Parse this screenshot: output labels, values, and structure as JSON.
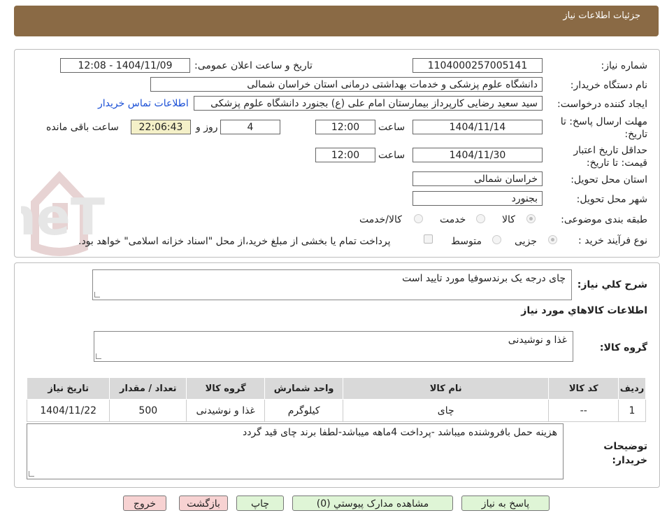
{
  "header": {
    "title": "جزئیات اطلاعات نیاز"
  },
  "labels": {
    "need_number": "شماره نیاز:",
    "announce_datetime": "تاریخ و ساعت اعلان عمومی:",
    "buyer_org": "نام دستگاه خریدار:",
    "requester": "ایجاد کننده درخواست:",
    "reply_deadline": "مهلت ارسال پاسخ: تا تاریخ:",
    "time": "ساعت",
    "days_and": "روز و",
    "remaining": "ساعت باقی مانده",
    "price_validity": "حداقل تاریخ اعتبار قیمت: تا تاریخ:",
    "province": "استان محل تحویل:",
    "city": "شهر محل تحویل:",
    "category": "طبقه بندی موضوعی:",
    "purchase_type": "نوع فرآیند خرید :",
    "general_desc": "شرح کلي نياز:",
    "goods_info": "اطلاعات کالاهاي مورد نياز",
    "goods_group": "گروه کالا:",
    "buyer_notes": "توضیحات خریدار:"
  },
  "values": {
    "need_number": "1104000257005141",
    "announce_datetime": "1404/11/09 - 12:08",
    "buyer_org": "دانشگاه علوم پزشکی و خدمات بهداشتی درمانی استان خراسان شمالی",
    "requester": "سید سعید رضایی کارپرداز بیمارستان امام علی (ع) بجنورد دانشگاه علوم پزشکی",
    "contact_link": "اطلاعات تماس خریدار",
    "reply_date": "1404/11/14",
    "reply_time": "12:00",
    "days": "4",
    "remaining_time": "22:06:43",
    "validity_date": "1404/11/30",
    "validity_time": "12:00",
    "province": "خراسان شمالی",
    "city": "بجنورد",
    "general_desc": "چای درجه یک برندسوفیا مورد تایید است",
    "goods_group": "غذا و نوشیدنی",
    "buyer_notes": "هزینه حمل بافروشنده میباشد -پرداخت 4ماهه میباشد-لطفا برند چای قید گردد"
  },
  "category_options": {
    "goods": "کالا",
    "service": "خدمت",
    "goods_service": "کالا/خدمت"
  },
  "purchase_options": {
    "partial": "جزیی",
    "medium": "متوسط",
    "treasury_note": "پرداخت تمام یا بخشی از مبلغ خرید،از محل \"اسناد خزانه اسلامی\" خواهد بود."
  },
  "table": {
    "headers": [
      "ردیف",
      "کد کالا",
      "نام کالا",
      "واحد شمارش",
      "گروه کالا",
      "تعداد / مقدار",
      "تاریخ نیاز"
    ],
    "rows": [
      [
        "1",
        "--",
        "چای",
        "کیلوگرم",
        "غذا و نوشیدنی",
        "500",
        "1404/11/22"
      ]
    ]
  },
  "buttons": {
    "reply": "پاسخ به نیاز",
    "attachments": "مشاهده مدارک پیوستي (0)",
    "print": "چاپ",
    "back": "بازگشت",
    "exit": "خروج"
  },
  "watermark": {
    "text": "AriaTender.neT"
  },
  "colors": {
    "header_bg": "#8a6a45",
    "link": "#1a4fd6",
    "remaining_bg": "#f4f0c8",
    "green_btn": "#dff5d6",
    "red_btn": "#f7d2d2"
  }
}
